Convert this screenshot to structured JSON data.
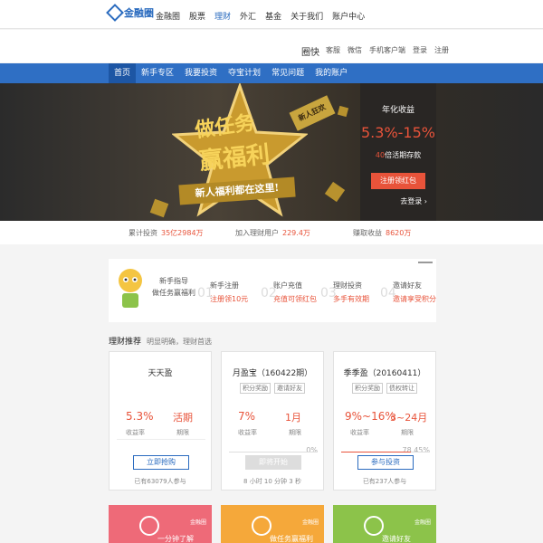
{
  "topbar": {
    "logo": "金融圈",
    "nav": [
      "金融圈",
      "股票",
      "理财",
      "外汇",
      "基金",
      "关于我们",
      "账户中心"
    ],
    "active_index": 2
  },
  "subbar": {
    "brand": "圈快",
    "links": [
      "客服",
      "微信",
      "手机客户端",
      "登录",
      "注册"
    ]
  },
  "mainnav": {
    "items": [
      "首页",
      "新手专区",
      "我要投资",
      "夺宝计划",
      "常见问题",
      "我的账户"
    ],
    "active_index": 0
  },
  "banner": {
    "line1": "做任务",
    "line2": "赢福利",
    "tag": "新人狂欢",
    "ribbon": "新人福利都在这里!"
  },
  "promo": {
    "label": "年化收益",
    "rate": "5.3%-15%",
    "sub_num": "40",
    "sub_text": "倍活期存款",
    "button": "注册领红包",
    "login": "去登录 ›"
  },
  "stats": [
    {
      "label": "累计投资",
      "value": "35亿2984万"
    },
    {
      "label": "加入理财用户",
      "value": "229.4万"
    },
    {
      "label": "赚取收益",
      "value": "8620万"
    }
  ],
  "steps": {
    "intro_line1": "新手指导",
    "intro_line2": "做任务赢福利",
    "items": [
      {
        "num": "01",
        "title": "新手注册",
        "desc": "注册领10元"
      },
      {
        "num": "02",
        "title": "账户充值",
        "desc": "充值可领红包"
      },
      {
        "num": "03",
        "title": "理财投资",
        "desc": "多手有效期"
      },
      {
        "num": "04",
        "title": "邀请好友",
        "desc": "邀请享受积分"
      }
    ]
  },
  "recommend": {
    "title": "理财推荐",
    "subtitle": "明显明确，理财首选"
  },
  "cards": [
    {
      "name": "天天盈",
      "tags": [],
      "v1": "5.3%",
      "v2": "活期",
      "l1": "收益率",
      "l2": "期限",
      "pct": "",
      "progress": 0,
      "button": "立即抢购",
      "button_style": "outline",
      "foot": "已有63079人参与"
    },
    {
      "name": "月盈宝（160422期）",
      "tags": [
        "积分奖励",
        "邀请好友"
      ],
      "v1": "7%",
      "v2": "1月",
      "l1": "收益率",
      "l2": "期限",
      "pct": "0%",
      "progress": 0,
      "button": "即将开始",
      "button_style": "disabled",
      "foot": "8 小时 10 分钟 3 秒"
    },
    {
      "name": "季季盈（20160411）",
      "tags": [
        "积分奖励",
        "债权转让"
      ],
      "v1": "9%~16%",
      "v2": "3~24月",
      "l1": "收益率",
      "l2": "期限",
      "pct": "78.45%",
      "progress": 0.7845,
      "button": "参与投资",
      "button_style": "outline",
      "foot": "已有237人参与"
    }
  ],
  "tiles": [
    {
      "label": "金融圈",
      "text": "一分钟了解",
      "color": "#ee6a78"
    },
    {
      "label": "金融圈",
      "text": "做任务赢福利",
      "color": "#f5a83a"
    },
    {
      "label": "金融圈",
      "text": "邀请好友",
      "color": "#8cc34a"
    }
  ]
}
